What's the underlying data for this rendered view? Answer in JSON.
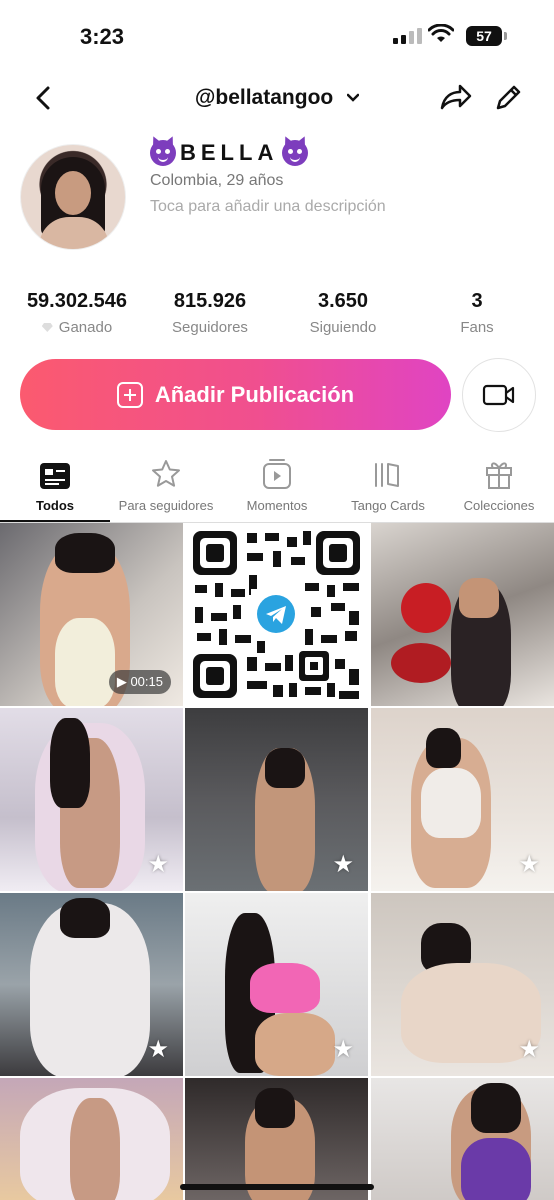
{
  "status": {
    "time": "3:23",
    "battery": "57"
  },
  "header": {
    "handle": "@bellatangoo"
  },
  "profile": {
    "name": "BELLA",
    "location": "Colombia, 29 años",
    "description_placeholder": "Toca para añadir una descripción"
  },
  "stats": [
    {
      "value": "59.302.546",
      "label": "Ganado"
    },
    {
      "value": "815.926",
      "label": "Seguidores"
    },
    {
      "value": "3.650",
      "label": "Siguiendo"
    },
    {
      "value": "3",
      "label": "Fans"
    }
  ],
  "actions": {
    "add_post": "Añadir Publicación"
  },
  "tabs": [
    {
      "label": "Todos"
    },
    {
      "label": "Para seguidores"
    },
    {
      "label": "Momentos"
    },
    {
      "label": "Tango Cards"
    },
    {
      "label": "Colecciones"
    }
  ],
  "grid": {
    "video_duration": "00:15"
  },
  "colors": {
    "accent_start": "#fb5a6f",
    "accent_end": "#e044c3"
  }
}
